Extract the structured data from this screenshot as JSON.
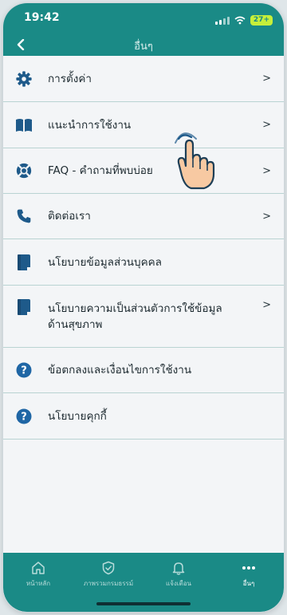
{
  "status_bar": {
    "time": "19:42",
    "battery": "27+"
  },
  "nav": {
    "title": "อื่นๆ"
  },
  "menu": [
    {
      "label": "การตั้งค่า",
      "icon": "gear-icon",
      "chevron": ">"
    },
    {
      "label": "แนะนำการใช้งาน",
      "icon": "book-icon",
      "chevron": ">"
    },
    {
      "label": "FAQ - คำถามที่พบบ่อย",
      "icon": "lifebuoy-icon",
      "chevron": ">"
    },
    {
      "label": "ติดต่อเรา",
      "icon": "phone-icon",
      "chevron": ">"
    },
    {
      "label": "นโยบายข้อมูลส่วนบุคคล",
      "icon": "document-icon",
      "chevron": ""
    },
    {
      "label": "นโยบายความเป็นส่วนตัวการใช้ข้อมูลด้านสุขภาพ",
      "icon": "document-icon",
      "chevron": ">"
    },
    {
      "label": "ข้อตกลงและเงื่อนไขการใช้งาน",
      "icon": "question-icon",
      "chevron": ""
    },
    {
      "label": "นโยบายคุกกี้",
      "icon": "question-icon",
      "chevron": ""
    }
  ],
  "tabs": [
    {
      "label": "หน้าหลัก",
      "icon": "home-icon"
    },
    {
      "label": "ภาพรวมกรมธรรม์",
      "icon": "shield-icon"
    },
    {
      "label": "แจ้งเตือน",
      "icon": "bell-icon"
    },
    {
      "label": "อื่นๆ",
      "icon": "more-icon"
    }
  ],
  "colors": {
    "primary": "#1a8a86",
    "icon_blue": "#1e5a8a",
    "help_blue": "#1f66a5",
    "divider": "#b9d3d2"
  }
}
